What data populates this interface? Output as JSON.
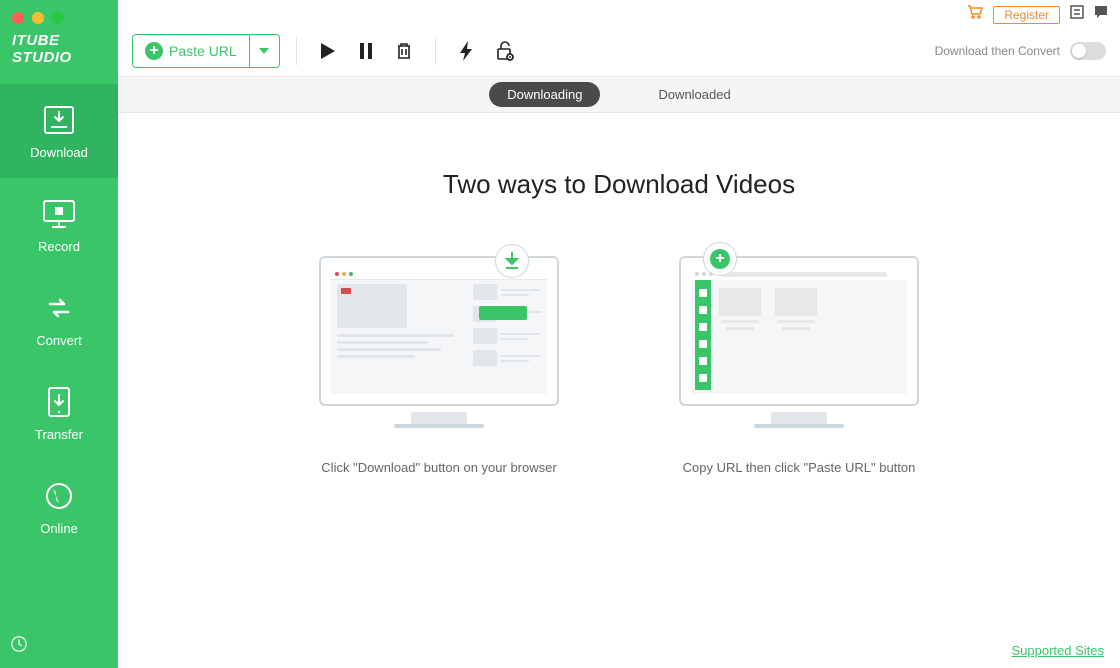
{
  "app": {
    "brand": "ITUBE STUDIO"
  },
  "sidebar": {
    "items": [
      {
        "label": "Download",
        "icon": "download-tray-icon"
      },
      {
        "label": "Record",
        "icon": "record-screen-icon"
      },
      {
        "label": "Convert",
        "icon": "convert-arrows-icon"
      },
      {
        "label": "Transfer",
        "icon": "transfer-device-icon"
      },
      {
        "label": "Online",
        "icon": "globe-icon"
      }
    ]
  },
  "topbar": {
    "register": "Register"
  },
  "toolbar": {
    "paste_label": "Paste URL",
    "convert_label": "Download then Convert"
  },
  "tabs": {
    "downloading": "Downloading",
    "downloaded": "Downloaded"
  },
  "content": {
    "headline": "Two ways to Download Videos",
    "way1_caption": "Click \"Download\" button on your browser",
    "way2_caption": "Copy URL then click \"Paste URL\" button"
  },
  "footer": {
    "supported_sites": "Supported Sites"
  }
}
